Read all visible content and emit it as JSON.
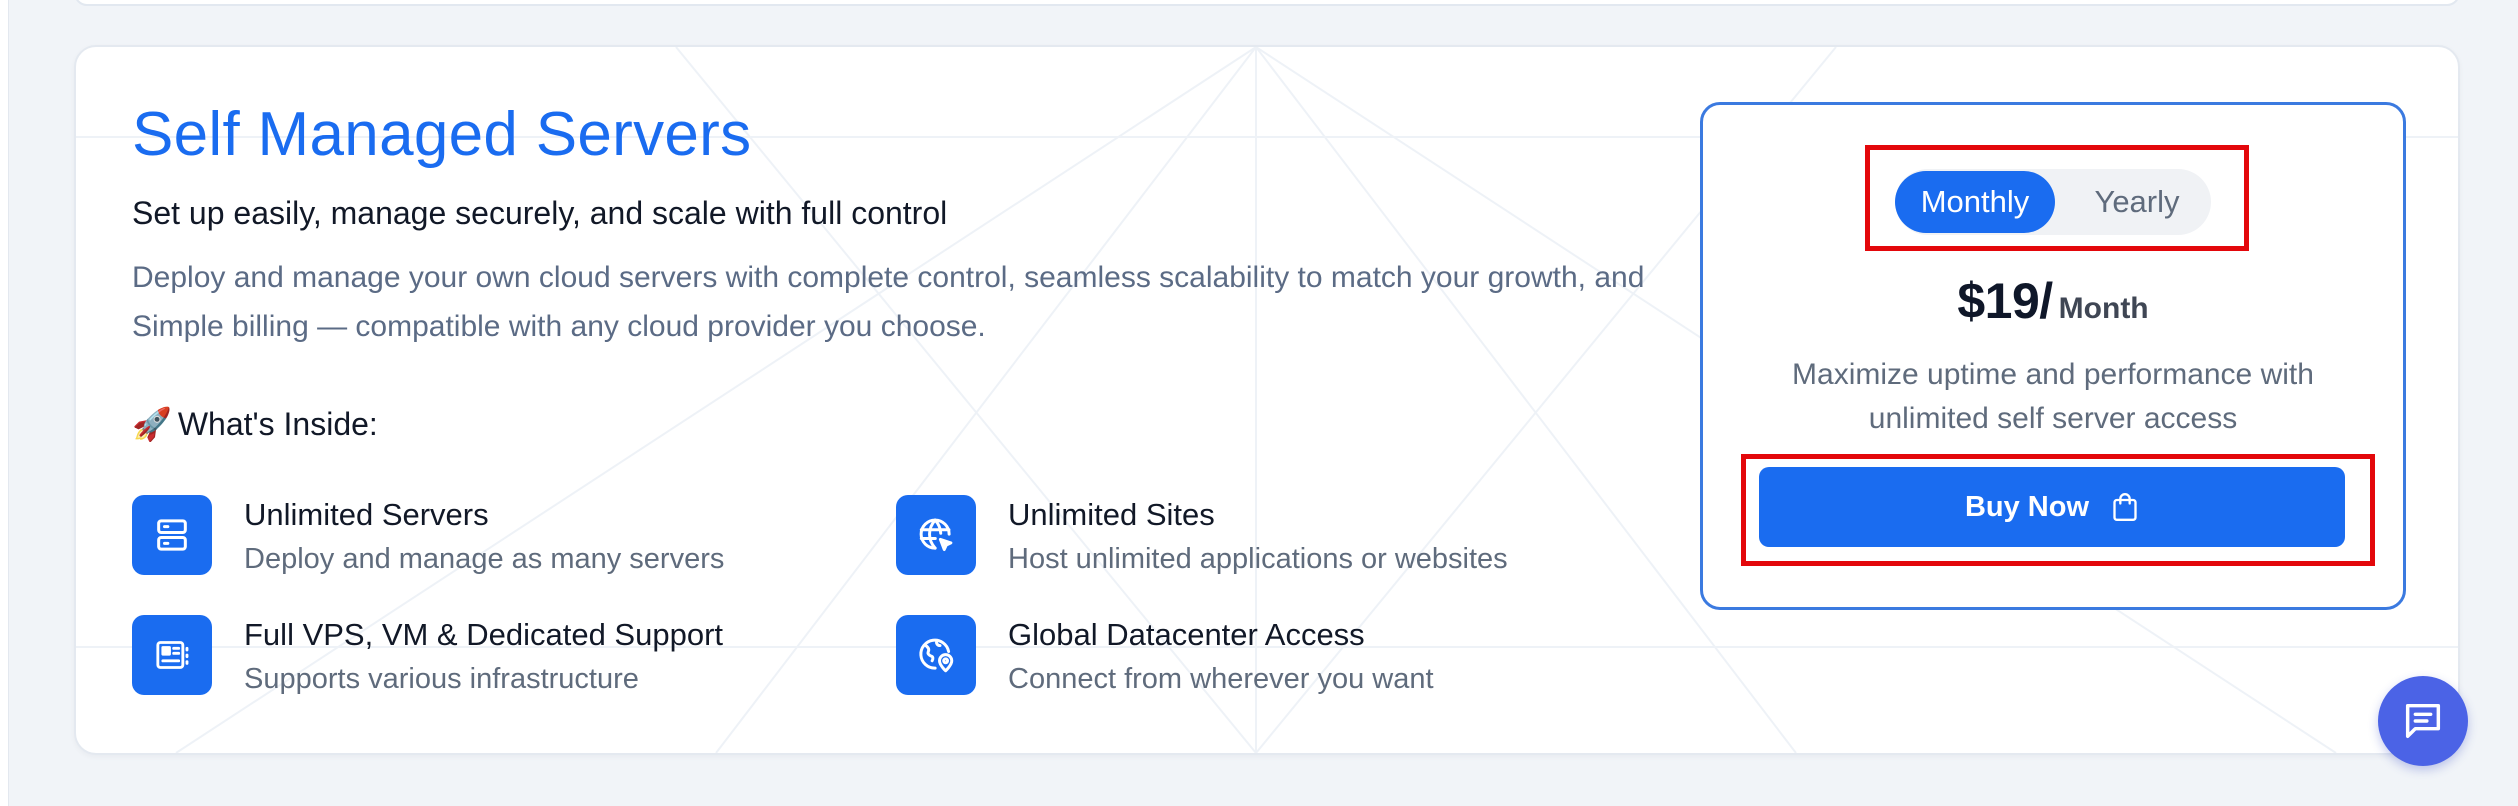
{
  "section": {
    "title": "Self Managed Servers",
    "subtitle": "Set up easily, manage securely, and scale with full control",
    "description": "Deploy and manage your own cloud servers with complete control, seamless scalability to match your growth, and Simple billing — compatible with any cloud provider you choose.",
    "inside_heading": "What's Inside:",
    "inside_icon": "🚀"
  },
  "features": [
    {
      "title": "Unlimited Servers",
      "desc": "Deploy and manage as many servers",
      "icon": "server-icon"
    },
    {
      "title": "Unlimited Sites",
      "desc": "Host unlimited applications or websites",
      "icon": "globe-cursor-icon"
    },
    {
      "title": "Full VPS, VM & Dedicated Support",
      "desc": "Supports various infrastructure",
      "icon": "cpu-icon"
    },
    {
      "title": "Global Datacenter Access",
      "desc": "Connect from wherever you want",
      "icon": "globe-pin-icon"
    }
  ],
  "pricing": {
    "toggle": {
      "monthly": "Monthly",
      "yearly": "Yearly",
      "selected": "Monthly"
    },
    "price": "$19/",
    "period": "Month",
    "description": "Maximize uptime and performance with unlimited self server access",
    "buy_label": "Buy Now"
  },
  "colors": {
    "accent": "#1a6cf0",
    "highlight": "#e3070b",
    "chat": "#4b63e6"
  }
}
